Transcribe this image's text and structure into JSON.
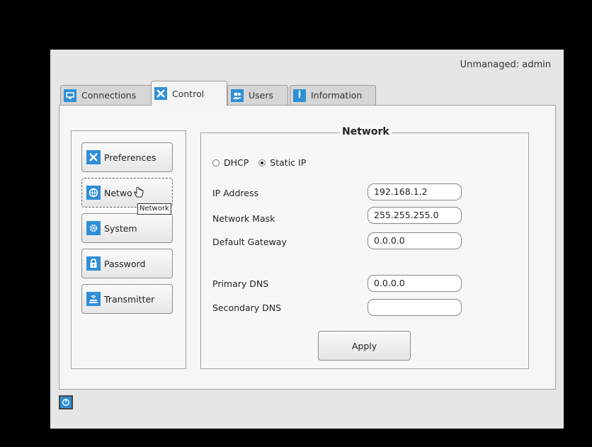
{
  "header": {
    "user_status": "Unmanaged: admin"
  },
  "tabs": [
    {
      "label": "Connections",
      "icon": "monitor-icon"
    },
    {
      "label": "Control",
      "icon": "tools-icon"
    },
    {
      "label": "Users",
      "icon": "users-icon"
    },
    {
      "label": "Information",
      "icon": "info-icon"
    }
  ],
  "sidebar": {
    "items": [
      {
        "label": "Preferences",
        "icon": "tools-icon"
      },
      {
        "label": "Netwo",
        "icon": "globe-icon"
      },
      {
        "label": "System",
        "icon": "gear-icon"
      },
      {
        "label": "Password",
        "icon": "lock-icon"
      },
      {
        "label": "Transmitter",
        "icon": "broadcast-icon"
      }
    ],
    "tooltip": "Network"
  },
  "network": {
    "title": "Network",
    "dhcp_label": "DHCP",
    "static_label": "Static IP",
    "selected_mode": "Static IP",
    "ip_label": "IP Address",
    "ip_value": "192.168.1.2",
    "mask_label": "Network Mask",
    "mask_value": "255.255.255.0",
    "gateway_label": "Default Gateway",
    "gateway_value": "0.0.0.0",
    "primary_dns_label": "Primary DNS",
    "primary_dns_value": "0.0.0.0",
    "secondary_dns_label": "Secondary DNS",
    "secondary_dns_value": "",
    "apply_label": "Apply"
  },
  "colors": {
    "accent": "#2f8fd6",
    "background": "#e6e6e6"
  }
}
